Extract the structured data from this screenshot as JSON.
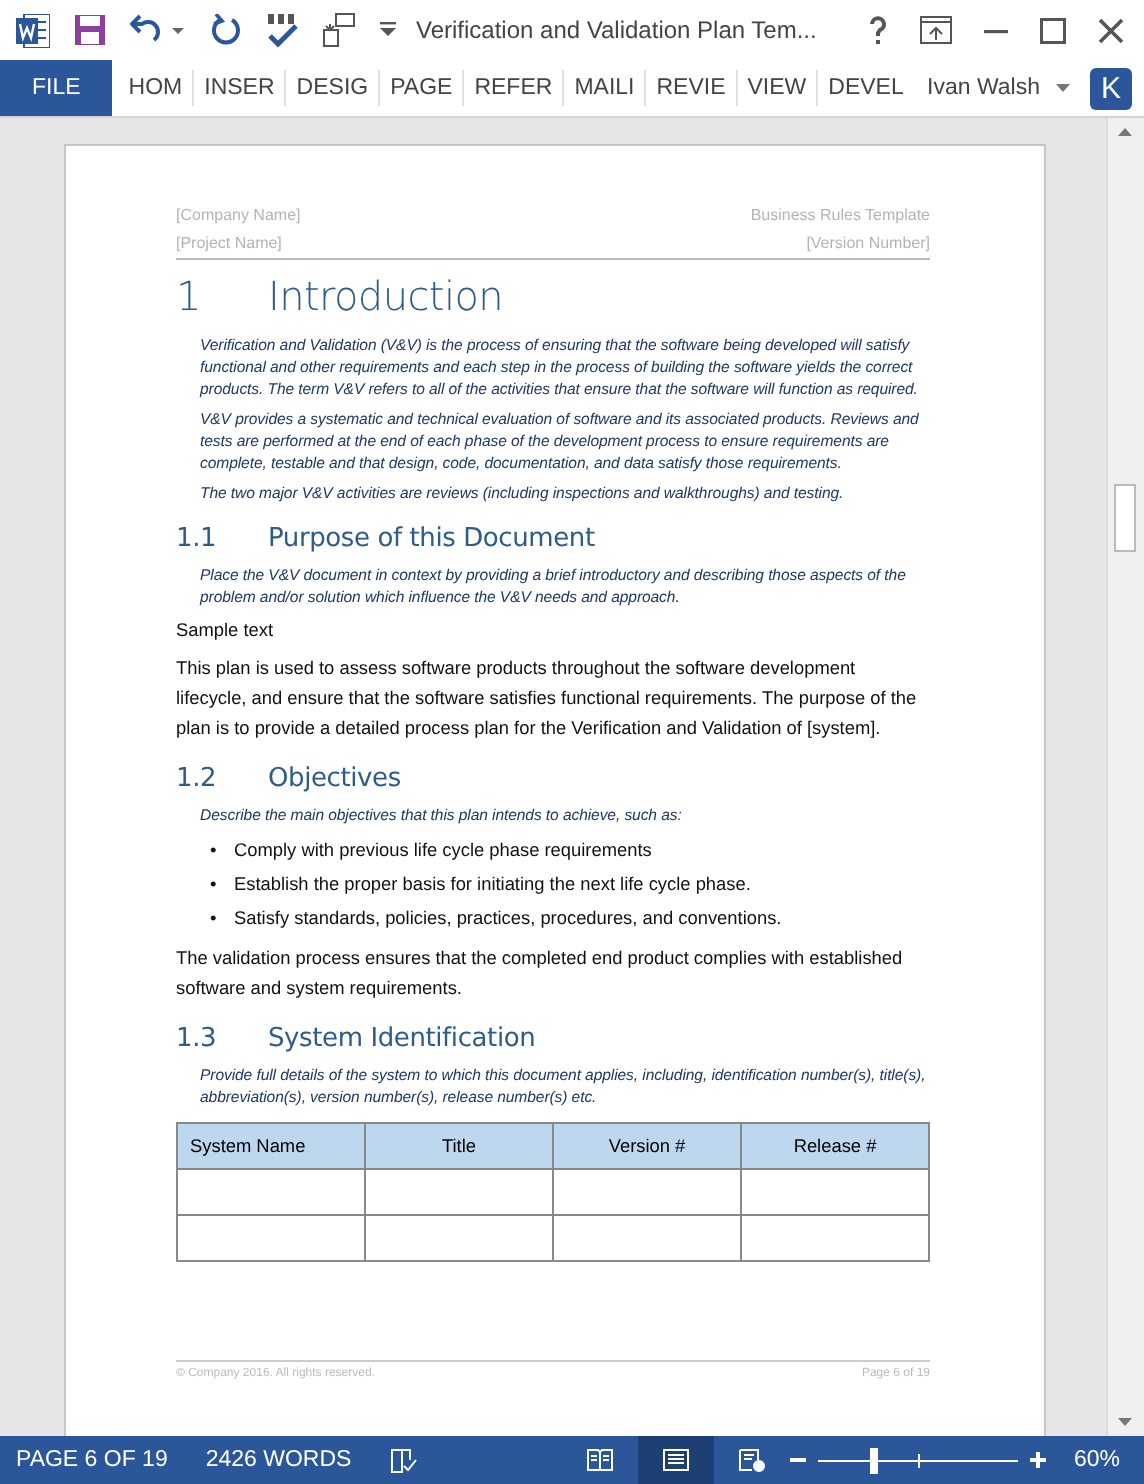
{
  "title_bar": {
    "title": "Verification and Validation Plan Tem..."
  },
  "ribbon": {
    "tabs": [
      {
        "label": "FILE",
        "kind": "file"
      },
      {
        "label": "HOM",
        "kind": "tab"
      },
      {
        "label": "INSER",
        "kind": "tab"
      },
      {
        "label": "DESIG",
        "kind": "tab"
      },
      {
        "label": "PAGE",
        "kind": "tab"
      },
      {
        "label": "REFER",
        "kind": "tab"
      },
      {
        "label": "MAILI",
        "kind": "tab"
      },
      {
        "label": "REVIE",
        "kind": "tab"
      },
      {
        "label": "VIEW",
        "kind": "tab"
      },
      {
        "label": "DEVEL",
        "kind": "tab"
      }
    ],
    "user": "Ivan Walsh",
    "avatar": "K"
  },
  "document": {
    "header": {
      "company": "[Company Name]",
      "template": "Business Rules Template",
      "project": "[Project Name]",
      "version": "[Version Number]"
    },
    "blocks": [
      {
        "kind": "h1",
        "number": "1",
        "text": "Introduction"
      },
      {
        "kind": "guide",
        "text": "Verification and Validation (V&V) is the process of ensuring that the software being developed will satisfy functional and other requirements and each step in the process of building the software yields the correct products. The term V&V refers to all of the activities that ensure that the software will function as required."
      },
      {
        "kind": "guide",
        "text": "V&V provides a systematic and technical evaluation of software and its associated products. Reviews and tests are performed at the end of each phase of the development process to ensure requirements are complete, testable and that design, code, documentation, and data satisfy those requirements."
      },
      {
        "kind": "guide",
        "text": "The two major V&V activities are reviews (including inspections and walkthroughs) and testing."
      },
      {
        "kind": "h2",
        "number": "1.1",
        "text": "Purpose of this Document"
      },
      {
        "kind": "guide",
        "text": "Place the V&V document in context by providing a brief introductory and describing those aspects of the problem and/or solution which influence the V&V needs and approach."
      },
      {
        "kind": "body",
        "text": "Sample text"
      },
      {
        "kind": "body",
        "text": "This plan is used to assess software products throughout the software development lifecycle, and ensure that the software satisfies functional requirements. The purpose of the plan is to provide a detailed process plan for the Verification and Validation of [system]."
      },
      {
        "kind": "h2",
        "number": "1.2",
        "text": "Objectives"
      },
      {
        "kind": "guide",
        "text": "Describe the main objectives that this plan intends to achieve, such as:"
      },
      {
        "kind": "bullets",
        "marker": "•",
        "items": [
          "Comply with previous life cycle phase requirements",
          "Establish the proper basis for initiating the next life cycle phase.",
          "Satisfy standards, policies, practices, procedures, and conventions."
        ]
      },
      {
        "kind": "body",
        "text": "The validation process ensures that the completed end product complies with established software and system requirements."
      },
      {
        "kind": "h2",
        "number": "1.3",
        "text": "System Identification"
      },
      {
        "kind": "guide",
        "text": "Provide full details of the system to which this document applies, including, identification number(s), title(s), abbreviation(s), version number(s), release number(s) etc."
      },
      {
        "kind": "table",
        "columns": [
          "System Name",
          "Title",
          "Version #",
          "Release #"
        ],
        "rows": [
          {
            "kind": "blank"
          },
          {
            "kind": "blank"
          }
        ]
      }
    ],
    "footer": {
      "copyright": "© Company 2016. All rights reserved.",
      "page": "Page 6 of 19"
    }
  },
  "status_bar": {
    "page": "PAGE 6 OF 19",
    "words": "2426 WORDS",
    "views": [
      {
        "selected": false
      },
      {
        "selected": true
      },
      {
        "selected": false
      }
    ],
    "zoom": {
      "level": 0.28,
      "reading": "60%"
    }
  }
}
